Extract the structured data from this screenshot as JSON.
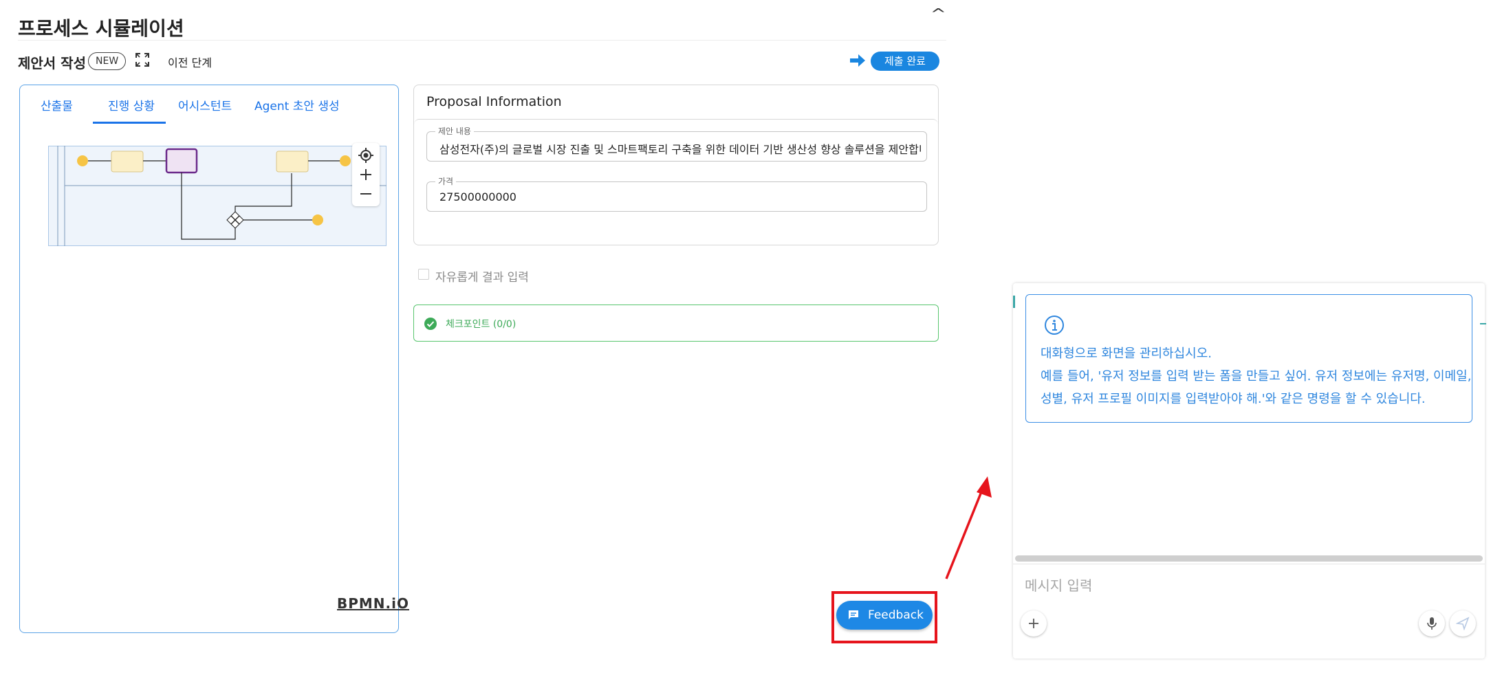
{
  "header": {
    "title": "프로세스 시뮬레이션",
    "collapse_symbol": "^"
  },
  "toolbar": {
    "step_title": "제안서 작성",
    "badge": "NEW",
    "prev_step": "이전 단계",
    "submit": "제출 완료"
  },
  "left_panel": {
    "tabs": [
      "산출물",
      "진행 상황",
      "어시스턴트",
      "Agent 초안 생성"
    ],
    "active_tab": "진행 상황",
    "logo": "BPMN.iO"
  },
  "proposal": {
    "title": "Proposal Information",
    "fields": [
      {
        "label": "제안 내용",
        "value": "삼성전자(주)의 글로벌 시장 진출 및 스마트팩토리 구축을 위한 데이터 기반 생산성 향상 솔루션을 제안합니다"
      },
      {
        "label": "가격",
        "value": "27500000000"
      }
    ],
    "free_input_label": "자유롭게 결과 입력",
    "checkpoint": "체크포인트 (0/0)"
  },
  "feedback": {
    "label": "Feedback"
  },
  "chat": {
    "info_lines": [
      "대화형으로 화면을 관리하십시오.",
      "예를 들어, '유저 정보를 입력 받는 폼을 만들고 싶어. 유저 정보에는 유저명, 이메일,",
      "성별, 유저 프로필 이미지를 입력받아야 해.'와 같은 명령을 할 수 있습니다."
    ],
    "input_placeholder": "메시지 입력"
  },
  "colors": {
    "accent": "#1a86e0",
    "checkpoint_green": "#3daa58",
    "highlight_red": "#e6141c",
    "info_blue": "#2e86de"
  }
}
